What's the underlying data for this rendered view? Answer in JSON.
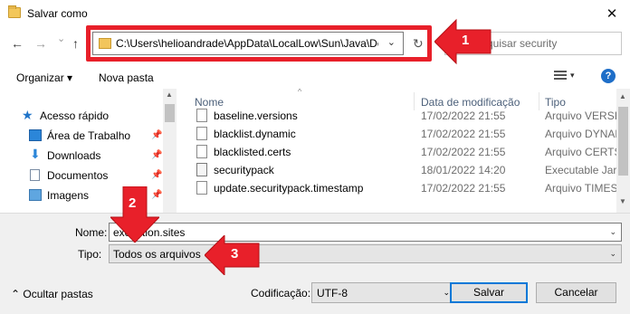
{
  "window": {
    "title": "Salvar como",
    "close_glyph": "✕"
  },
  "nav": {
    "back": "←",
    "forward": "→",
    "recent": "⌄",
    "up": "↑",
    "address_path": "C:\\Users\\helioandrade\\AppData\\LocalLow\\Sun\\Java\\Depl",
    "refresh": "↻",
    "search_placeholder": "quisar security"
  },
  "toolbar": {
    "organize": "Organizar ▾",
    "new_folder": "Nova pasta",
    "help": "?"
  },
  "sidebar": {
    "items": [
      {
        "label": "Acesso rápido",
        "icon": "star-icon",
        "pinned": false
      },
      {
        "label": "Área de Trabalho",
        "icon": "desktop-icon",
        "pinned": true
      },
      {
        "label": "Downloads",
        "icon": "download-icon",
        "pinned": true
      },
      {
        "label": "Documentos",
        "icon": "document-icon",
        "pinned": true
      },
      {
        "label": "Imagens",
        "icon": "pictures-icon",
        "pinned": true
      }
    ]
  },
  "filelist": {
    "columns": {
      "name": "Nome",
      "date": "Data de modificação",
      "type": "Tipo"
    },
    "rows": [
      {
        "name": "baseline.versions",
        "date": "17/02/2022 21:55",
        "type": "Arquivo VERSIONS",
        "icon": "file-icon"
      },
      {
        "name": "blacklist.dynamic",
        "date": "17/02/2022 21:55",
        "type": "Arquivo DYNAMIC",
        "icon": "file-icon"
      },
      {
        "name": "blacklisted.certs",
        "date": "17/02/2022 21:55",
        "type": "Arquivo CERTS",
        "icon": "file-icon"
      },
      {
        "name": "securitypack",
        "date": "18/01/2022 14:20",
        "type": "Executable Jar File",
        "icon": "jar-icon"
      },
      {
        "name": "update.securitypack.timestamp",
        "date": "17/02/2022 21:55",
        "type": "Arquivo TIMESTAMP",
        "icon": "file-icon"
      }
    ]
  },
  "form": {
    "name_label": "Nome:",
    "name_value": "exception.sites",
    "type_label": "Tipo:",
    "type_value": "Todos os arquivos",
    "encoding_label": "Codificação:",
    "encoding_value": "UTF-8",
    "hide_folders": "Ocultar pastas",
    "save": "Salvar",
    "cancel": "Cancelar"
  },
  "annotations": {
    "arrow1": "1",
    "arrow2": "2",
    "arrow3": "3",
    "color": "#e8202a"
  }
}
